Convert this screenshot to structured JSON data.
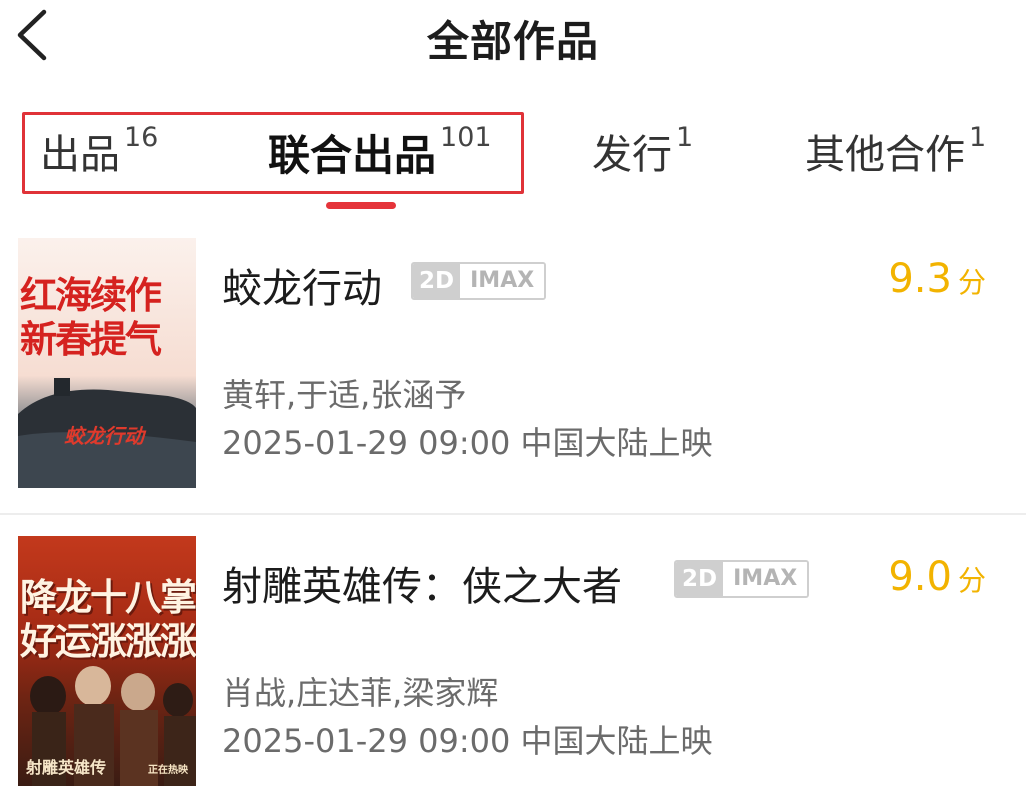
{
  "header": {
    "title": "全部作品",
    "back_icon": "chevron-left-icon"
  },
  "tabs": [
    {
      "label": "出品",
      "count": "16",
      "active": false
    },
    {
      "label": "联合出品",
      "count": "101",
      "active": true
    },
    {
      "label": "发行",
      "count": "1",
      "active": false
    },
    {
      "label": "其他合作",
      "count": "1",
      "active": false
    }
  ],
  "colors": {
    "accent_red": "#e5343a",
    "score_yellow": "#f2b300",
    "badge_gray": "#cfcfcf"
  },
  "movies": [
    {
      "title": "蛟龙行动",
      "format_2d": "2D",
      "format_imax": "IMAX",
      "score": "9.3",
      "score_unit": "分",
      "cast": "黄轩,于适,张涵予",
      "release": "2025-01-29 09:00 中国大陆上映",
      "poster": {
        "line1": "红海续作",
        "line2": "新春提气",
        "logo": "蛟龙行动"
      }
    },
    {
      "title": "射雕英雄传：侠之大者",
      "format_2d": "2D",
      "format_imax": "IMAX",
      "score": "9.0",
      "score_unit": "分",
      "cast": "肖战,庄达菲,梁家辉",
      "release": "2025-01-29 09:00 中国大陆上映",
      "poster": {
        "line1": "降龙十八掌!",
        "line2": "好运涨涨涨",
        "logo": "射雕英雄传",
        "tag": "正在热映"
      }
    }
  ]
}
